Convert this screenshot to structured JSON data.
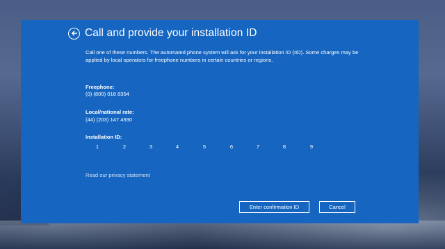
{
  "dialog": {
    "title": "Call and provide your installation ID",
    "description": "Call one of these numbers. The automated phone system will ask for your installation ID (IID). Some charges may be applied by local operators for freephone numbers in certain countries or regions.",
    "freephone": {
      "label": "Freephone:",
      "number": "(0) (800) 018 8354"
    },
    "local_rate": {
      "label": "Local/national rate:",
      "number": "(44) (203) 147 4930"
    },
    "installation_id": {
      "label": "Installation ID:",
      "columns": [
        "1",
        "2",
        "3",
        "4",
        "5",
        "6",
        "7",
        "8",
        "9"
      ]
    },
    "privacy_link": "Read our privacy statement",
    "buttons": {
      "confirm": "Enter confirmation ID",
      "cancel": "Cancel"
    },
    "icons": {
      "back": "back-arrow-icon"
    },
    "colors": {
      "panel": "#1666c1",
      "text": "#ffffff",
      "link": "#cfe0f5"
    }
  }
}
